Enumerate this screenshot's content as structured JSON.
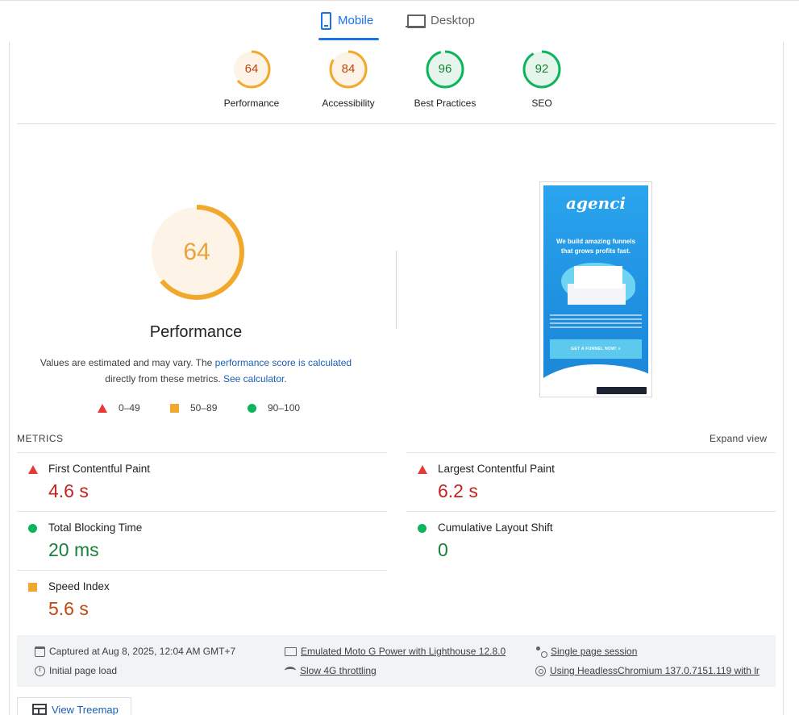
{
  "tabs": [
    {
      "label": "Mobile",
      "icon": "phone-icon",
      "active": true
    },
    {
      "label": "Desktop",
      "icon": "laptop-icon",
      "active": false
    }
  ],
  "scores": [
    {
      "label": "Performance",
      "value": "64",
      "status": "average",
      "fraction": 0.64
    },
    {
      "label": "Accessibility",
      "value": "84",
      "status": "average",
      "fraction": 0.84
    },
    {
      "label": "Best Practices",
      "value": "96",
      "status": "pass",
      "fraction": 0.96
    },
    {
      "label": "SEO",
      "value": "92",
      "status": "pass",
      "fraction": 0.92
    }
  ],
  "colors": {
    "average": "#f2a82c",
    "average_text": "#c0470f",
    "average_bg": "#fdf3e6",
    "pass": "#0cb55b",
    "pass_text": "#188038",
    "pass_bg": "#e7f6ec",
    "fail": "#e53935",
    "link": "#1a5fb4"
  },
  "performance": {
    "score": "64",
    "fraction": 0.64,
    "title": "Performance",
    "note_prefix": "Values are estimated and may vary. The ",
    "note_link1": "performance score is calculated",
    "note_middle": "directly from these metrics. ",
    "note_link2": "See calculator",
    "note_suffix": "."
  },
  "legend": [
    {
      "range": "0–49",
      "shape": "triangle-icon"
    },
    {
      "range": "50–89",
      "shape": "square-icon"
    },
    {
      "range": "90–100",
      "shape": "circle-icon"
    }
  ],
  "screenshot": {
    "logo": "agenci",
    "headline": "We build amazing funnels that grows profits fast.",
    "cta": "GET A FUNNEL NOW! »"
  },
  "metrics": {
    "label": "METRICS",
    "expand": "Expand view",
    "items": [
      {
        "name": "First Contentful Paint",
        "value": "4.6 s",
        "status": "fail"
      },
      {
        "name": "Largest Contentful Paint",
        "value": "6.2 s",
        "status": "fail"
      },
      {
        "name": "Total Blocking Time",
        "value": "20 ms",
        "status": "pass"
      },
      {
        "name": "Cumulative Layout Shift",
        "value": "0",
        "status": "pass"
      },
      {
        "name": "Speed Index",
        "value": "5.6 s",
        "status": "average"
      }
    ]
  },
  "info": {
    "captured": "Captured at Aug 8, 2025, 12:04 AM GMT+7",
    "initial_load": "Initial page load",
    "device": "Emulated Moto G Power with Lighthouse 12.8.0",
    "throttling": "Slow 4G throttling",
    "session": "Single page session",
    "browser": "Using HeadlessChromium 137.0.7151.119 with lr"
  },
  "treemap_label": "View Treemap"
}
